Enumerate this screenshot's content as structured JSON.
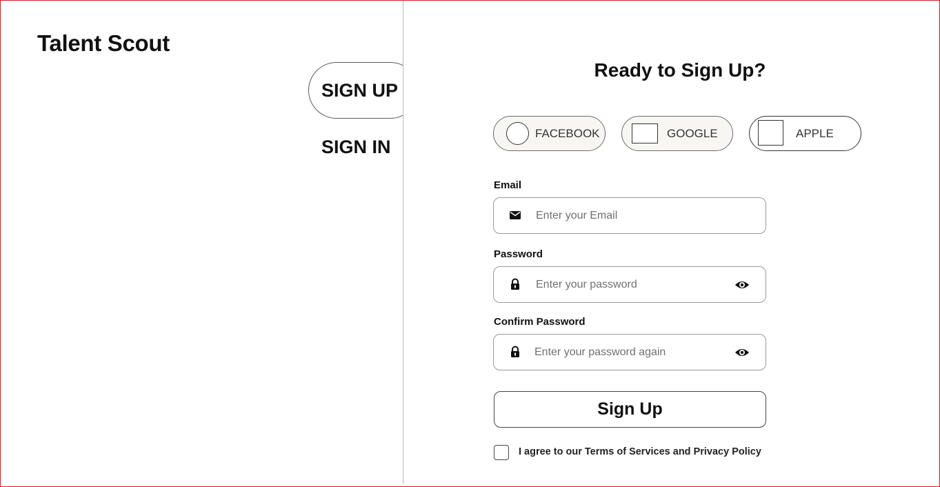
{
  "app": {
    "brand": "Talent Scout"
  },
  "tabs": {
    "signup_label": "SIGN UP",
    "signin_label": "SIGN IN"
  },
  "form": {
    "heading": "Ready to Sign Up?",
    "social": {
      "facebook_label": "FACEBOOK",
      "google_label": "GOOGLE",
      "apple_label": "APPLE"
    },
    "email": {
      "label": "Email",
      "placeholder": "Enter your Email",
      "value": "",
      "icon": "mail-icon"
    },
    "password": {
      "label": "Password",
      "placeholder": "Enter your password",
      "value": "",
      "icon": "lock-icon",
      "toggle_icon": "eye-icon"
    },
    "confirm_password": {
      "label": "Confirm Password",
      "placeholder": "Enter your password again",
      "value": "",
      "icon": "lock-icon",
      "toggle_icon": "eye-icon"
    },
    "submit_label": "Sign Up",
    "agree_text": "I agree to our Terms of Services and Privacy Policy",
    "agree_checked": false
  },
  "colors": {
    "frame_border": "#d41c1c",
    "divider": "#b8b8b8",
    "social_bg": "#f7f6f3"
  }
}
